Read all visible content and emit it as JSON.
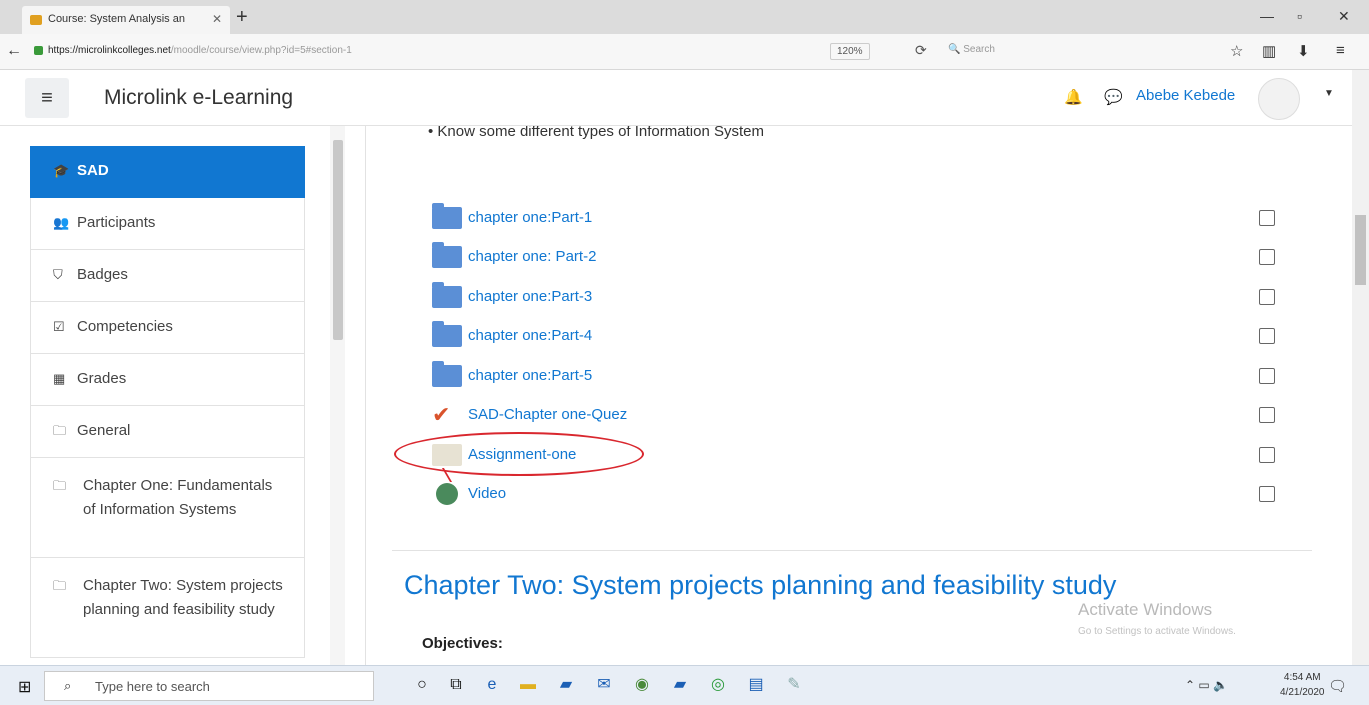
{
  "browser": {
    "tab_title": "Course: System Analysis an",
    "url_host": "https://microlinkcolleges.net",
    "url_path": "/moodle/course/view.php?id=5#section-1",
    "zoom": "120%",
    "search_placeholder": "Search"
  },
  "navbar": {
    "brand": "Microlink e-Learning",
    "user_name": "Abebe Kebede"
  },
  "drawer": {
    "items": [
      {
        "label": "SAD",
        "icon": "graduation-cap-icon",
        "active": true
      },
      {
        "label": "Participants",
        "icon": "users-icon"
      },
      {
        "label": "Badges",
        "icon": "shield-icon"
      },
      {
        "label": "Competencies",
        "icon": "checklist-icon"
      },
      {
        "label": "Grades",
        "icon": "table-icon"
      },
      {
        "label": "General",
        "icon": "folder-icon"
      },
      {
        "label": "Chapter One: Fundamentals of Information Systems",
        "icon": "folder-icon"
      },
      {
        "label": "Chapter Two: System projects planning and feasibility study",
        "icon": "folder-icon"
      }
    ]
  },
  "main": {
    "objective_text": "Know some different types of Information System",
    "activities": [
      {
        "label": "chapter one:Part-1",
        "type": "folder"
      },
      {
        "label": "chapter one: Part-2",
        "type": "folder"
      },
      {
        "label": "chapter one:Part-3",
        "type": "folder"
      },
      {
        "label": "chapter one:Part-4",
        "type": "folder"
      },
      {
        "label": "chapter one:Part-5",
        "type": "folder"
      },
      {
        "label": "SAD-Chapter one-Quez",
        "type": "quiz"
      },
      {
        "label": "Assignment-one",
        "type": "assignment"
      },
      {
        "label": "Video",
        "type": "url"
      }
    ],
    "section_title": "Chapter Two: System projects planning and feasibility study",
    "objectives_heading": "Objectives:",
    "watermark_title": "Activate Windows",
    "watermark_sub": "Go to Settings to activate Windows."
  },
  "taskbar": {
    "search_placeholder": "Type here to search",
    "time": "4:54 AM",
    "date": "4/21/2020"
  }
}
